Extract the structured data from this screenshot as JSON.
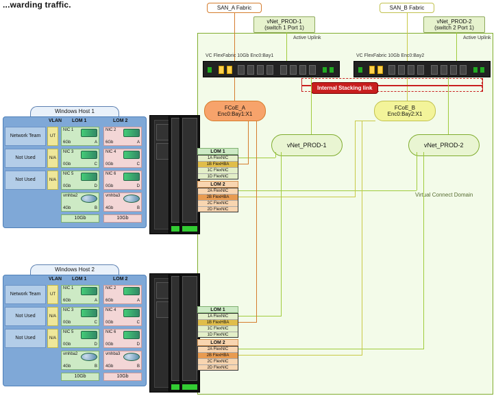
{
  "page": {
    "cropText": "...warding traffic."
  },
  "fabrics": {
    "a": "SAN_A Fabric",
    "b": "SAN_B Fabric"
  },
  "uplinks": {
    "a": {
      "name": "vNet_PROD-1",
      "port": "(switch 1 Port 1)",
      "state": "Active Uplink"
    },
    "b": {
      "name": "vNet_PROD-2",
      "port": "(switch 2 Port 1)",
      "state": "Active Uplink"
    }
  },
  "vcModules": {
    "a": "VC FlexFabric 10Gb Enc0:Bay1",
    "b": "VC FlexFabric 10Gb Enc0:Bay2"
  },
  "stacking": "Internal Stacking link",
  "fcoe": {
    "a": {
      "name": "FCoE_A",
      "port": "Enc0:Bay1:X1"
    },
    "b": {
      "name": "FCoE_B",
      "port": "Enc0:Bay2:X1"
    }
  },
  "vnets": {
    "a": "vNet_PROD-1",
    "b": "vNet_PROD-2"
  },
  "vcDomain": "Virtual Connect Domain",
  "hosts": {
    "1": {
      "title": "Windows Host 1",
      "columns": {
        "vlan": "VLAN",
        "lom1": "LOM 1",
        "lom2": "LOM 2"
      },
      "rows": [
        {
          "label": "Network Team",
          "vlan": "UT"
        },
        {
          "label": "Not Used",
          "vlan": "N/A"
        },
        {
          "label": "Not Used",
          "vlan": "N/A"
        }
      ],
      "lom1": {
        "nics": [
          {
            "name": "NIC 1",
            "bw": "6Gb",
            "sfx": "A"
          },
          {
            "name": "NIC 3",
            "bw": "0Gb",
            "sfx": "C"
          },
          {
            "name": "NIC 5",
            "bw": "0Gb",
            "sfx": "D"
          },
          {
            "name": "vmhba2",
            "bw": "4Gb",
            "sfx": "B",
            "disk": true
          }
        ],
        "total": "10Gb"
      },
      "lom2": {
        "nics": [
          {
            "name": "NIC 2",
            "bw": "6Gb",
            "sfx": "A"
          },
          {
            "name": "NIC 4",
            "bw": "0Gb",
            "sfx": "C"
          },
          {
            "name": "NIC 6",
            "bw": "0Gb",
            "sfx": "D"
          },
          {
            "name": "vmhba3",
            "bw": "4Gb",
            "sfx": "B",
            "disk": true
          }
        ],
        "total": "10Gb"
      }
    },
    "2": {
      "title": "Windows Host 2",
      "columns": {
        "vlan": "VLAN",
        "lom1": "LOM 1",
        "lom2": "LOM 2"
      },
      "rows": [
        {
          "label": "Network Team",
          "vlan": "UT"
        },
        {
          "label": "Not Used",
          "vlan": "N/A"
        },
        {
          "label": "Not Used",
          "vlan": "N/A"
        }
      ],
      "lom1": {
        "nics": [
          {
            "name": "NIC 1",
            "bw": "6Gb",
            "sfx": "A"
          },
          {
            "name": "NIC 3",
            "bw": "0Gb",
            "sfx": "C"
          },
          {
            "name": "NIC 5",
            "bw": "0Gb",
            "sfx": "D"
          },
          {
            "name": "vmhba2",
            "bw": "4Gb",
            "sfx": "B",
            "disk": true
          }
        ],
        "total": "10Gb"
      },
      "lom2": {
        "nics": [
          {
            "name": "NIC 2",
            "bw": "6Gb",
            "sfx": "A"
          },
          {
            "name": "NIC 4",
            "bw": "0Gb",
            "sfx": "C"
          },
          {
            "name": "NIC 6",
            "bw": "0Gb",
            "sfx": "D"
          },
          {
            "name": "vmhba3",
            "bw": "4Gb",
            "sfx": "B",
            "disk": true
          }
        ],
        "total": "10Gb"
      }
    }
  },
  "lomBlocks": {
    "h1": {
      "lom1": {
        "title": "LOM 1",
        "flex": [
          "1A FlexNIC",
          "1B FlexHBA",
          "1C FlexNIC",
          "1D FlexNIC"
        ]
      },
      "lom2": {
        "title": "LOM 2",
        "flex": [
          "2A FlexNIC",
          "2B FlexHBA",
          "2C FlexNIC",
          "2D FlexNIC"
        ]
      }
    },
    "h2": {
      "lom1": {
        "title": "LOM 1",
        "flex": [
          "1A FlexNIC",
          "1B FlexHBA",
          "1C FlexNIC",
          "1D FlexNIC"
        ]
      },
      "lom2": {
        "title": "LOM 2",
        "flex": [
          "2A FlexNIC",
          "2B FlexHBA",
          "2C FlexNIC",
          "2D FlexNIC"
        ]
      }
    }
  }
}
